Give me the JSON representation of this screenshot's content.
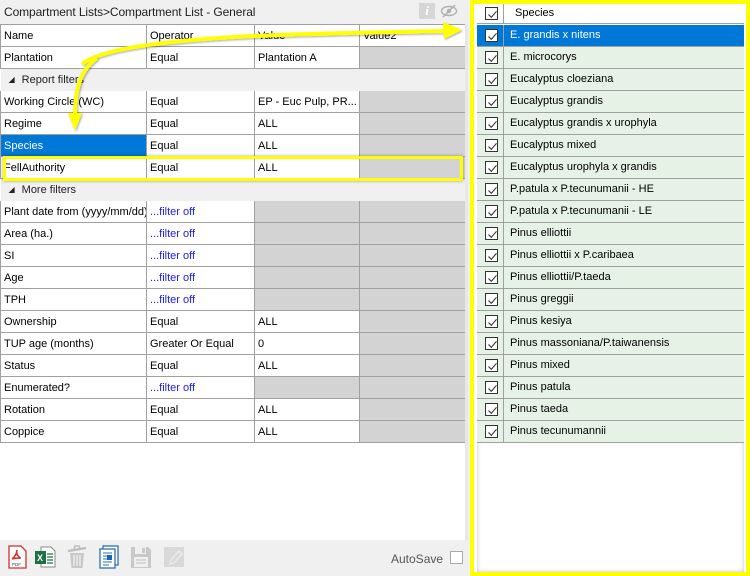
{
  "title": "Compartment Lists>Compartment List - General",
  "header_icons": {
    "info": "info-icon",
    "visibility": "eye-slash-icon"
  },
  "grid": {
    "columns": [
      "Name",
      "Operator",
      "Value",
      "Value2"
    ],
    "rows": [
      {
        "type": "row",
        "name": "Plantation",
        "operator": "Equal",
        "value": "Plantation A",
        "value2": ""
      },
      {
        "type": "group",
        "label": "Report filters"
      },
      {
        "type": "row",
        "name": "Working Circle (WC)",
        "operator": "Equal",
        "value": "EP - Euc Pulp, PR...",
        "value2": ""
      },
      {
        "type": "row",
        "name": "Regime",
        "operator": "Equal",
        "value": "ALL",
        "value2": ""
      },
      {
        "type": "row",
        "name": "Species",
        "operator": "Equal",
        "value": "ALL",
        "value2": "",
        "selected": true
      },
      {
        "type": "row",
        "name": "FellAuthority",
        "operator": "Equal",
        "value": "ALL",
        "value2": ""
      },
      {
        "type": "group",
        "label": "More filters"
      },
      {
        "type": "row",
        "name": "Plant date from (yyyy/mm/dd)",
        "operator": "...filter off",
        "value": "",
        "value2": "",
        "off": true
      },
      {
        "type": "row",
        "name": "Area (ha.)",
        "operator": "...filter off",
        "value": "",
        "value2": "",
        "off": true
      },
      {
        "type": "row",
        "name": "SI",
        "operator": "...filter off",
        "value": "",
        "value2": "",
        "off": true
      },
      {
        "type": "row",
        "name": "Age",
        "operator": "...filter off",
        "value": "",
        "value2": "",
        "off": true
      },
      {
        "type": "row",
        "name": "TPH",
        "operator": "...filter off",
        "value": "",
        "value2": "",
        "off": true
      },
      {
        "type": "row",
        "name": "Ownership",
        "operator": "Equal",
        "value": "ALL",
        "value2": ""
      },
      {
        "type": "row",
        "name": "TUP age (months)",
        "operator": "Greater Or Equal",
        "value": "0",
        "value2": ""
      },
      {
        "type": "row",
        "name": "Status",
        "operator": "Equal",
        "value": "ALL",
        "value2": ""
      },
      {
        "type": "row",
        "name": "Enumerated?",
        "operator": "...filter off",
        "value": "",
        "value2": "",
        "off": true
      },
      {
        "type": "row",
        "name": "Rotation",
        "operator": "Equal",
        "value": "ALL",
        "value2": ""
      },
      {
        "type": "row",
        "name": "Coppice",
        "operator": "Equal",
        "value": "ALL",
        "value2": ""
      }
    ]
  },
  "toolbar": {
    "buttons": [
      {
        "name": "export-pdf-button",
        "icon": "pdf-icon",
        "enabled": true
      },
      {
        "name": "export-excel-button",
        "icon": "excel-icon",
        "enabled": true
      },
      {
        "name": "delete-button",
        "icon": "trash-icon",
        "enabled": false
      },
      {
        "name": "report-button",
        "icon": "document-icon",
        "enabled": true
      },
      {
        "name": "save-button",
        "icon": "floppy-disk-icon",
        "enabled": false
      },
      {
        "name": "edit-button",
        "icon": "pencil-icon",
        "enabled": false
      }
    ],
    "autosave_label": "AutoSave",
    "autosave_checked": false
  },
  "species_panel": {
    "header": "Species",
    "header_checked": true,
    "items": [
      {
        "label": "E. grandis x nitens",
        "checked": true,
        "selected": true
      },
      {
        "label": "E. microcorys",
        "checked": true
      },
      {
        "label": "Eucalyptus cloeziana",
        "checked": true
      },
      {
        "label": "Eucalyptus grandis",
        "checked": true
      },
      {
        "label": "Eucalyptus grandis x urophyla",
        "checked": true
      },
      {
        "label": "Eucalyptus mixed",
        "checked": true
      },
      {
        "label": "Eucalyptus urophyla x grandis",
        "checked": true
      },
      {
        "label": "P.patula x P.tecunumanii - HE",
        "checked": true
      },
      {
        "label": "P.patula x P.tecunumanii - LE",
        "checked": true
      },
      {
        "label": "Pinus elliottii",
        "checked": true
      },
      {
        "label": "Pinus elliottii x P.caribaea",
        "checked": true
      },
      {
        "label": "Pinus elliottii/P.taeda",
        "checked": true
      },
      {
        "label": "Pinus greggii",
        "checked": true
      },
      {
        "label": "Pinus kesiya",
        "checked": true
      },
      {
        "label": "Pinus massoniana/P.taiwanensis",
        "checked": true
      },
      {
        "label": "Pinus mixed",
        "checked": true
      },
      {
        "label": "Pinus patula",
        "checked": true
      },
      {
        "label": "Pinus taeda",
        "checked": true
      },
      {
        "label": "Pinus tecunumannii",
        "checked": true
      }
    ]
  },
  "colors": {
    "selection": "#0078d7",
    "annotation": "#ffff00",
    "link": "#1a1aff",
    "disabled_cell": "#d3d3d3",
    "species_row_bg": "#e6f2e6"
  }
}
